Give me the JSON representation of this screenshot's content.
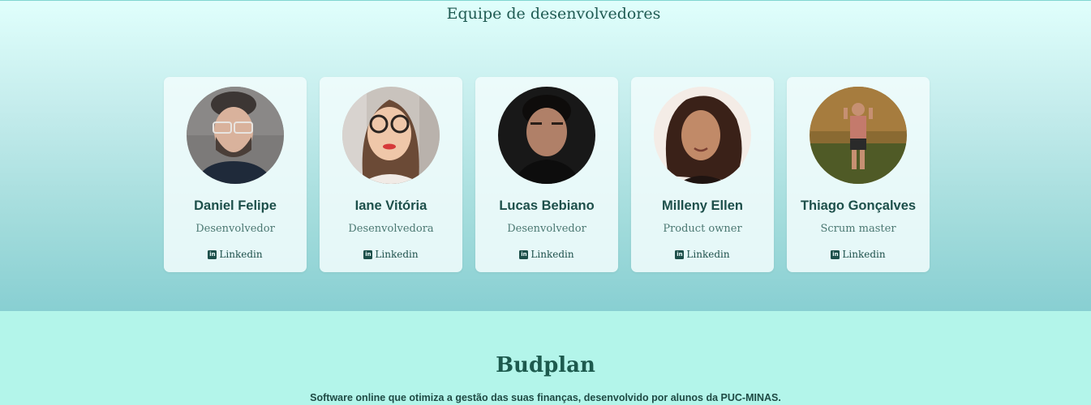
{
  "team": {
    "title": "Equipe de desenvolvedores",
    "members": [
      {
        "name": "Daniel Felipe",
        "role": "Desenvolvedor",
        "link": "Linkedin"
      },
      {
        "name": "Iane Vitória",
        "role": "Desenvolvedora",
        "link": "Linkedin"
      },
      {
        "name": "Lucas Bebiano",
        "role": "Desenvolvedor",
        "link": "Linkedin"
      },
      {
        "name": "Milleny Ellen",
        "role": "Product owner",
        "link": "Linkedin"
      },
      {
        "name": "Thiago Gonçalves",
        "role": "Scrum master",
        "link": "Linkedin"
      }
    ]
  },
  "footer": {
    "brand": "Budplan",
    "tagline": "Software online que otimiza a gestão das suas finanças, desenvolvido por alunos da PUC-MINAS."
  },
  "colors": {
    "accent": "#1d4f4a",
    "footer_bg": "#b3f5ea"
  }
}
